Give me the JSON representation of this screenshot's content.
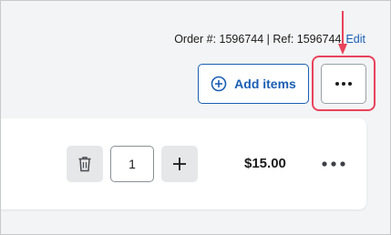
{
  "header": {
    "order_text": "Order #: 1596744 | Ref: 1596744",
    "edit_label": "Edit"
  },
  "toolbar": {
    "add_items_label": "Add items",
    "more_icon": "ellipsis-icon"
  },
  "line_item": {
    "quantity": "1",
    "price": "$15.00",
    "delete_icon": "trash-icon",
    "increment_icon": "plus-icon",
    "more_icon": "ellipsis-icon"
  },
  "colors": {
    "accent": "#1a5fb4",
    "highlight": "#e8435b"
  }
}
